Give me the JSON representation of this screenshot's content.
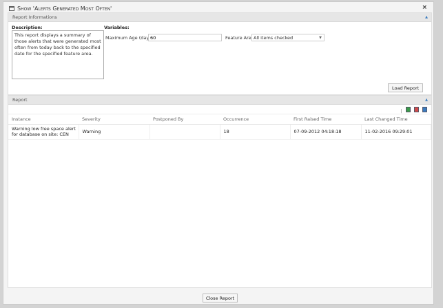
{
  "dialog": {
    "title": "Show 'Alerts Generated Most Often'",
    "icon": "window-icon",
    "close": "×"
  },
  "info": {
    "header": "Report Informations",
    "description_label": "Description:",
    "description": "This report displays a summary of those alerts that were generated most often from today back to the specified date for the specified feature area.",
    "variables_label": "Variables:",
    "max_age_label": "Maximum Age (days)",
    "max_age_value": "60",
    "feature_area_label": "Feature Area",
    "feature_area_value": "All items checked",
    "load_button": "Load Report"
  },
  "report": {
    "header": "Report",
    "export_icons": [
      "export-excel-icon",
      "export-pdf-icon",
      "export-csv-icon"
    ],
    "columns": [
      "Instance",
      "Severity",
      "Postponed By",
      "Occurrence",
      "First Raised Time",
      "Last Changed Time"
    ],
    "rows": [
      [
        "Warning low free space alert for database on site: CEN",
        "Warning",
        "",
        "18",
        "07-09-2012 04:18:18",
        "11-02-2016 09:29:01"
      ]
    ]
  },
  "footer": {
    "close_button": "Close Report"
  },
  "colors": {
    "background": "#d3d3d3",
    "panel_header": "#e6e6e6",
    "accent": "#3a7bbf"
  }
}
